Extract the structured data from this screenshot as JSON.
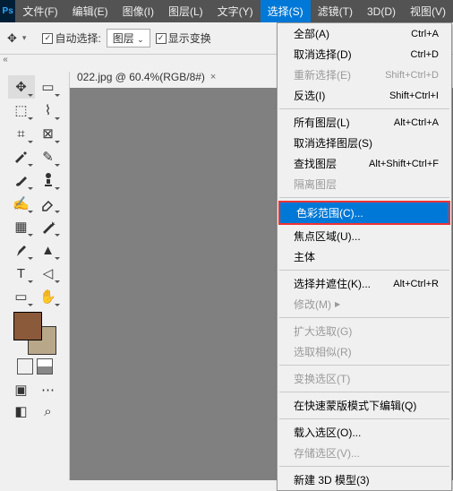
{
  "menubar": {
    "items": [
      "文件(F)",
      "编辑(E)",
      "图像(I)",
      "图层(L)",
      "文字(Y)",
      "选择(S)",
      "滤镜(T)",
      "3D(D)",
      "视图(V)"
    ],
    "active_index": 5
  },
  "options": {
    "auto_select_label": "自动选择:",
    "dropdown_value": "图层",
    "show_transform_label": "显示变换",
    "move_icon": "✥",
    "dropdown_arrow": "▾"
  },
  "collapse_glyph": "«",
  "tab": {
    "label": "022.jpg @ 60.4%(RGB/8#)",
    "close_glyph": "×"
  },
  "tools": {
    "items": [
      {
        "name": "move-tool",
        "glyph": "✥"
      },
      {
        "name": "artboard-tool",
        "glyph": "▭"
      },
      {
        "name": "marquee-tool",
        "glyph": "⬚"
      },
      {
        "name": "lasso-tool",
        "glyph": "⌇"
      },
      {
        "name": "crop-tool",
        "glyph": "⌗"
      },
      {
        "name": "frame-tool",
        "glyph": "⊠"
      },
      {
        "name": "eyedropper-tool",
        "glyph": "pipette"
      },
      {
        "name": "spot-heal-tool",
        "glyph": "✎"
      },
      {
        "name": "brush-tool",
        "glyph": "brush"
      },
      {
        "name": "clone-tool",
        "glyph": "stamp"
      },
      {
        "name": "history-brush-tool",
        "glyph": "✍"
      },
      {
        "name": "eraser-tool",
        "glyph": "eraser"
      },
      {
        "name": "gradient-tool",
        "glyph": "▦"
      },
      {
        "name": "magic-wand-tool",
        "glyph": "wand"
      },
      {
        "name": "pen-tool",
        "glyph": "pen"
      },
      {
        "name": "path-select-tool",
        "glyph": "▲"
      },
      {
        "name": "type-tool",
        "glyph": "T"
      },
      {
        "name": "direct-select-tool",
        "glyph": "◁"
      },
      {
        "name": "shape-tool",
        "glyph": "▭"
      },
      {
        "name": "hand-tool",
        "glyph": "✋"
      }
    ]
  },
  "dropdown": {
    "groups": [
      [
        {
          "label": "全部(A)",
          "shortcut": "Ctrl+A"
        },
        {
          "label": "取消选择(D)",
          "shortcut": "Ctrl+D"
        },
        {
          "label": "重新选择(E)",
          "shortcut": "Shift+Ctrl+D",
          "disabled": true
        },
        {
          "label": "反选(I)",
          "shortcut": "Shift+Ctrl+I"
        }
      ],
      [
        {
          "label": "所有图层(L)",
          "shortcut": "Alt+Ctrl+A"
        },
        {
          "label": "取消选择图层(S)"
        },
        {
          "label": "查找图层",
          "shortcut": "Alt+Shift+Ctrl+F"
        },
        {
          "label": "隔离图层",
          "disabled": true
        }
      ],
      [
        {
          "label": "色彩范围(C)...",
          "highlight": true,
          "hover": true
        },
        {
          "label": "焦点区域(U)..."
        },
        {
          "label": "主体"
        }
      ],
      [
        {
          "label": "选择并遮住(K)...",
          "shortcut": "Alt+Ctrl+R"
        },
        {
          "label": "修改(M)",
          "submenu": true,
          "disabled": true
        }
      ],
      [
        {
          "label": "扩大选取(G)",
          "disabled": true
        },
        {
          "label": "选取相似(R)",
          "disabled": true
        }
      ],
      [
        {
          "label": "变换选区(T)",
          "disabled": true
        }
      ],
      [
        {
          "label": "在快速蒙版模式下编辑(Q)"
        }
      ],
      [
        {
          "label": "载入选区(O)..."
        },
        {
          "label": "存储选区(V)...",
          "disabled": true
        }
      ],
      [
        {
          "label": "新建 3D 模型(3)"
        }
      ]
    ]
  }
}
